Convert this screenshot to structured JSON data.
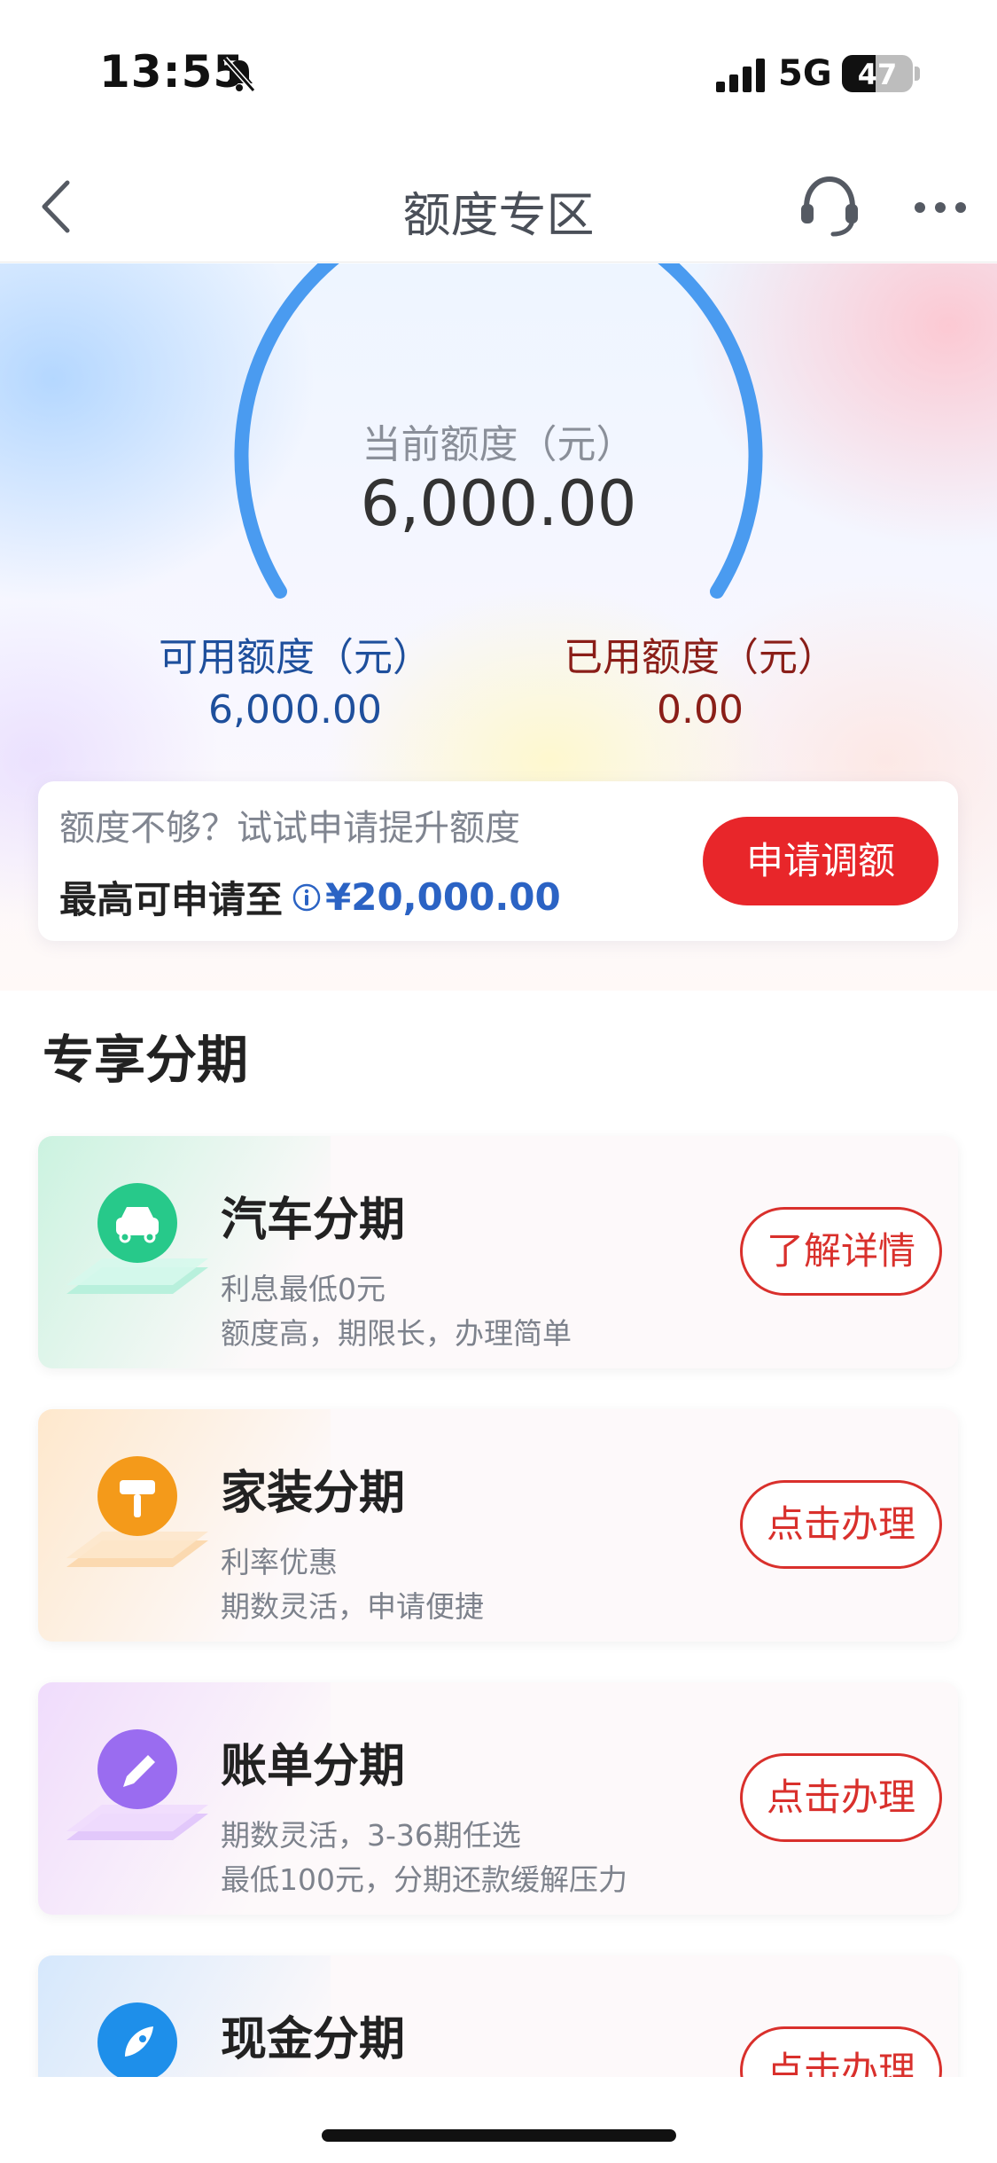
{
  "status_bar": {
    "time": "13:55",
    "network": "5G",
    "battery": "47",
    "battery_level": 0.47
  },
  "nav": {
    "title": "额度专区",
    "back_icon": "chevron-left-icon",
    "service_icon": "headset-icon",
    "more_icon": "more-dots-icon"
  },
  "credit": {
    "current_label": "当前额度（元）",
    "current_value": "6,000.00",
    "available_label": "可用额度（元）",
    "available_value": "6,000.00",
    "used_label": "已用额度（元）",
    "used_value": "0.00",
    "gauge_color": "#4a9bf0"
  },
  "raise": {
    "hint": "额度不够？试试申请提升额度",
    "max_label": "最高可申请至",
    "max_amount": "¥20,000.00",
    "button": "申请调额"
  },
  "section": {
    "title": "专享分期"
  },
  "plans": [
    {
      "title": "汽车分期",
      "line1": "利息最低0元",
      "line2": "额度高，期限长，办理简单",
      "button": "了解详情",
      "icon": "car-icon",
      "color": "#27c98a"
    },
    {
      "title": "家装分期",
      "line1": "利率优惠",
      "line2": "期数灵活，申请便捷",
      "button": "点击办理",
      "icon": "paint-roller-icon",
      "color": "#f49a1a"
    },
    {
      "title": "账单分期",
      "line1": "期数灵活，3-36期任选",
      "line2": "最低100元，分期还款缓解压力",
      "button": "点击办理",
      "icon": "pencil-icon",
      "color": "#9a6cf0"
    },
    {
      "title": "现金分期",
      "button": "点击办理",
      "icon": "rocket-icon",
      "color": "#1e8fea"
    }
  ]
}
